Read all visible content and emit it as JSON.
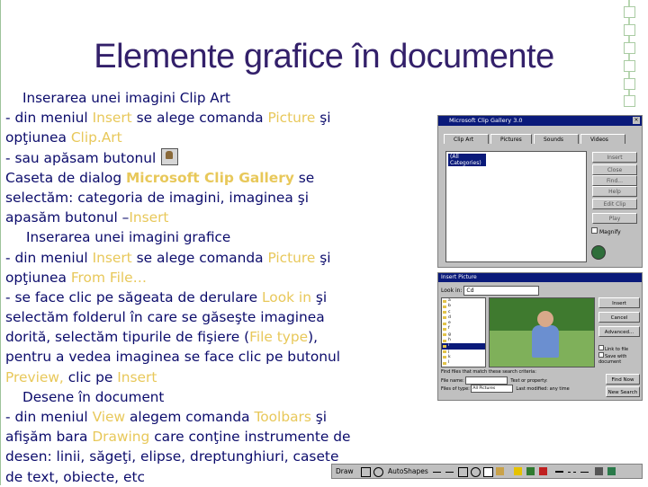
{
  "title": "Elemente grafice în documente",
  "body": {
    "lines": [
      [
        {
          "t": "Inserarea unei imagini Clip Art",
          "c": "head",
          "indent": 19
        }
      ],
      [
        {
          "t": "- din meniul "
        },
        {
          "t": "Insert",
          "c": "hl"
        },
        {
          "t": " se alege comanda "
        },
        {
          "t": "Picture",
          "c": "hl"
        },
        {
          "t": " şi"
        }
      ],
      [
        {
          "t": "opţiunea "
        },
        {
          "t": "Clip.Art",
          "c": "hl"
        }
      ],
      [
        {
          "t": "- sau apăsam butonul"
        },
        {
          "t": "",
          "c": "iconbtn",
          "name": "clip-art-button-icon"
        }
      ],
      [
        {
          "t": "Caseta de dialog "
        },
        {
          "t": "Microsoft Clip Gallery",
          "c": "hlb"
        },
        {
          "t": " se"
        }
      ],
      [
        {
          "t": "selectăm: categoria de imagini, imaginea şi"
        }
      ],
      [
        {
          "t": "apasăm  butonul –"
        },
        {
          "t": "Insert",
          "c": "hl"
        }
      ],
      [
        {
          "t": "Inserarea unei imagini grafice",
          "c": "head",
          "indent": 23
        }
      ],
      [
        {
          "t": "- din meniul "
        },
        {
          "t": "Insert",
          "c": "hl"
        },
        {
          "t": " se alege comanda "
        },
        {
          "t": "Picture",
          "c": "hl"
        },
        {
          "t": " şi"
        }
      ],
      [
        {
          "t": "opţiunea "
        },
        {
          "t": "From File…",
          "c": "hl"
        }
      ],
      [
        {
          "t": "- se face clic pe săgeata de derulare "
        },
        {
          "t": "Look in",
          "c": "hl"
        },
        {
          "t": "  şi"
        }
      ],
      [
        {
          "t": "selectăm folderul în care se găseşte imaginea"
        }
      ],
      [
        {
          "t": "dorită,  selectăm tipurile de fişiere ("
        },
        {
          "t": "File type",
          "c": "hl"
        },
        {
          "t": "),"
        }
      ],
      [
        {
          "t": "pentru a vedea imaginea se face clic pe butonul"
        }
      ],
      [
        {
          "t": "Preview,",
          "c": "hl"
        },
        {
          "t": "  clic pe "
        },
        {
          "t": "Insert",
          "c": "hl"
        }
      ],
      [
        {
          "t": "Desene în document",
          "c": "head",
          "indent": 19
        }
      ],
      [
        {
          "t": "- din meniul "
        },
        {
          "t": "View",
          "c": "hl"
        },
        {
          "t": " alegem comanda "
        },
        {
          "t": "Toolbars",
          "c": "hl"
        },
        {
          "t": "  şi"
        }
      ],
      [
        {
          "t": "afişăm bara "
        },
        {
          "t": "Drawing",
          "c": "hl"
        },
        {
          "t": " care conţine instrumente de"
        }
      ],
      [
        {
          "t": "desen: linii, săgeţi, elipse, dreptunghiuri, casete"
        }
      ],
      [
        {
          "t": "de text, obiecte, etc"
        }
      ]
    ]
  },
  "clip_gallery": {
    "title": "Microsoft Clip Gallery 3.0",
    "tabs": [
      "Clip Art",
      "Pictures",
      "Sounds",
      "Videos"
    ],
    "selected_category": "(All Categories)",
    "buttons": [
      "Insert",
      "Close",
      "Find...",
      "Help",
      "Edit Clip",
      "Play"
    ],
    "checkbox": "Magnify"
  },
  "insert_picture": {
    "title": "Insert Picture",
    "look_in_label": "Look in:",
    "look_in_value": "Cd",
    "folders": [
      "a",
      "b",
      "c",
      "d",
      "e",
      "f",
      "g",
      "h",
      "i",
      "j",
      "k",
      "l"
    ],
    "buttons": [
      "Insert",
      "Cancel",
      "Advanced..."
    ],
    "checkbox_link": "Link to file",
    "checkbox_save": "Save with document",
    "find_label": "Find files that match these search criteria:",
    "file_name_label": "File name:",
    "file_type_label": "Files of type:",
    "file_type_value": "All Pictures",
    "find_now": "Find Now",
    "new_search": "New Search",
    "text_label": "Text or property:",
    "modified_label": "Last modified:",
    "modified_value": "any time"
  },
  "drawing_toolbar": {
    "draw_label": "Draw",
    "autoshapes_label": "AutoShapes"
  }
}
